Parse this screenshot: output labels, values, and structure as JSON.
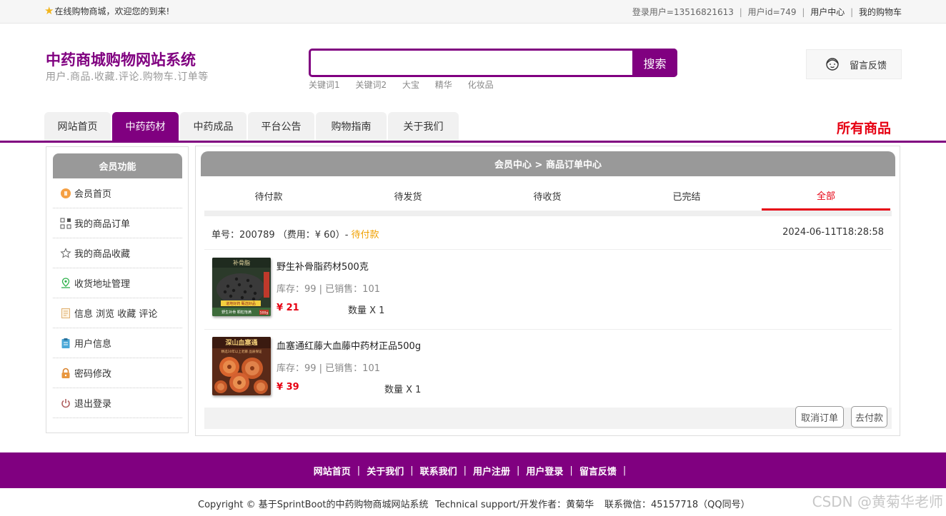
{
  "topbar": {
    "welcome": "在线购物商城，欢迎您的到来!",
    "login_user": "登录用户=13516821613",
    "user_id": "用户id=749",
    "user_center": "用户中心",
    "cart": "我的购物车",
    "sep": "|"
  },
  "brand": {
    "title": "中药商城购物网站系统",
    "subtitle": "用户.商品.收藏.评论.购物车.订单等"
  },
  "search": {
    "value": "",
    "button": "搜索",
    "keywords": [
      "关键词1",
      "关键词2",
      "大宝",
      "精华",
      "化妆品"
    ]
  },
  "feedback": {
    "label": "留言反馈"
  },
  "nav": {
    "tabs": [
      "网站首页",
      "中药药材",
      "中药成品",
      "平台公告",
      "购物指南",
      "关于我们"
    ],
    "active": "中药药材",
    "right_label": "所有商品"
  },
  "sidebar": {
    "title": "会员功能",
    "items": [
      "会员首页",
      "我的商品订单",
      "我的商品收藏",
      "收货地址管理",
      "信息 浏览 收藏 评论",
      "用户信息",
      "密码修改",
      "退出登录"
    ]
  },
  "main": {
    "breadcrumb": "会员中心 > 商品订单中心",
    "status_tabs": [
      "待付款",
      "待发货",
      "待收货",
      "已完结",
      "全部"
    ],
    "active_tab": "全部",
    "order": {
      "no_label": "单号：200789 （费用：¥ 60）- ",
      "status": "待付款",
      "date": "2024-06-11T18:28:58"
    },
    "products": [
      {
        "name": "野生补骨脂药材500克",
        "stock": "库存：99 | 已销售：101",
        "price": "¥ 21",
        "qty": "数量 X 1"
      },
      {
        "name": "血塞通红藤大血藤中药材正品500g",
        "stock": "库存：99 | 已销售：101",
        "price": "¥ 39",
        "qty": "数量 X 1"
      }
    ],
    "buttons": {
      "cancel": "取消订单",
      "pay": "去付款"
    }
  },
  "footer": {
    "links": [
      "网站首页",
      "关于我们",
      "联系我们",
      "用户注册",
      "用户登录",
      "留言反馈"
    ],
    "sep": "|",
    "copyright": "Copyright © 基于SprintBoot的中药购物商城网站系统",
    "support": "Technical support/开发作者：黄菊华",
    "contact": "联系微信：45157718（QQ同号）"
  },
  "watermark": "CSDN @黄菊华老师",
  "image_text": {
    "p1_top": "补骨脂",
    "p1_band": "道地好药 甄选好品",
    "p1_foot": "野生补骨 颗粒饱满",
    "p1_badge": "500g",
    "p2_top": "深山血塞通",
    "p2_band": "精选10年以上老藤 品质保证"
  },
  "colors": {
    "brand": "#800080",
    "accent": "#e60012",
    "pending": "#f0a000"
  }
}
